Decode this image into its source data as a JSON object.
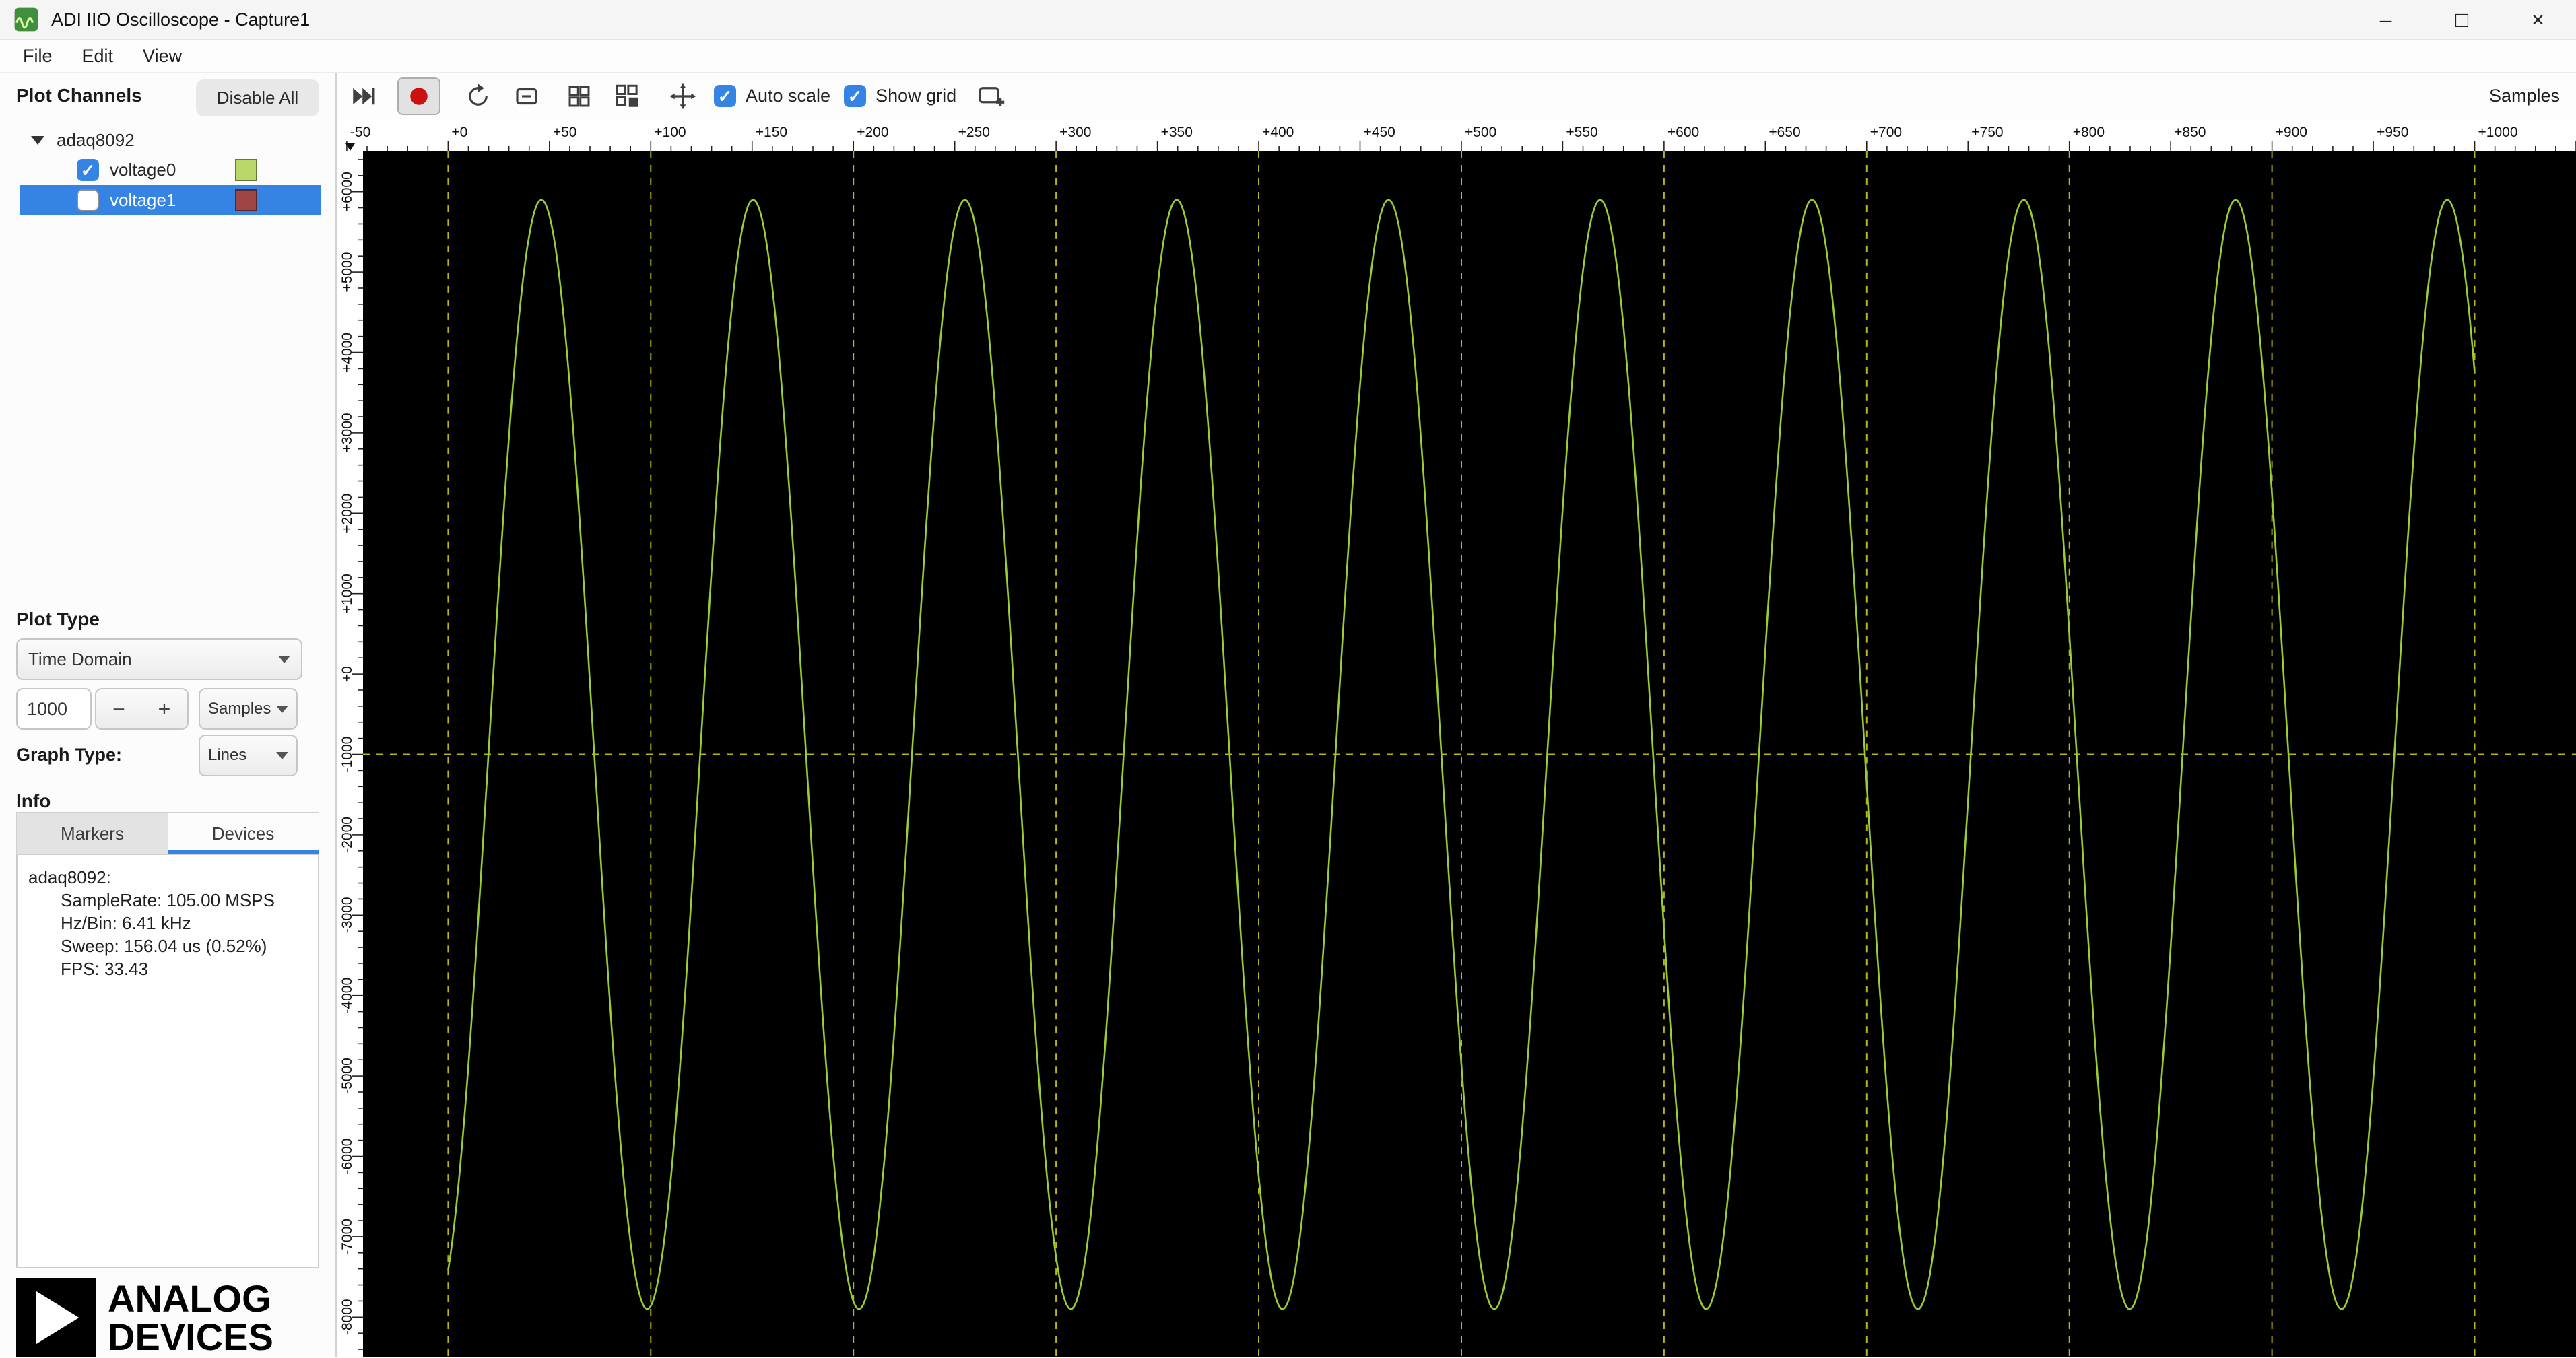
{
  "window": {
    "title": "ADI IIO Oscilloscope - Capture1",
    "controls": {
      "minimize": "–",
      "maximize": "□",
      "close": "×"
    }
  },
  "menu": {
    "items": [
      "File",
      "Edit",
      "View"
    ]
  },
  "toolbar": {
    "icons": [
      "skip-end",
      "record",
      "restart",
      "zoom-out",
      "zoom-fit",
      "export",
      "pan",
      "new-plot"
    ],
    "auto_scale": {
      "label": "Auto scale",
      "checked": true
    },
    "show_grid": {
      "label": "Show grid",
      "checked": true
    },
    "samples_label": "Samples"
  },
  "sidebar": {
    "plot_channels_label": "Plot Channels",
    "disable_all_label": "Disable All",
    "device_tree": {
      "device": "adaq8092",
      "channels": [
        {
          "name": "voltage0",
          "checked": true,
          "selected": false,
          "color": "#b9d869"
        },
        {
          "name": "voltage1",
          "checked": false,
          "selected": true,
          "color": "#a04545"
        }
      ]
    },
    "plot_type_label": "Plot Type",
    "plot_type_value": "Time Domain",
    "sample_count": "1000",
    "sample_unit": "Samples",
    "graph_type_label": "Graph Type:",
    "graph_type_value": "Lines",
    "info_label": "Info",
    "tabs": [
      {
        "label": "Markers",
        "active": false
      },
      {
        "label": "Devices",
        "active": true
      }
    ],
    "device_info": {
      "title": "adaq8092:",
      "lines": [
        "SampleRate: 105.00 MSPS",
        "Hz/Bin: 6.41 kHz",
        "Sweep: 156.04 us (0.52%)",
        "FPS: 33.43"
      ]
    },
    "logo": {
      "line1": "ANALOG",
      "line2": "DEVICES"
    }
  },
  "colors": {
    "accent": "#3584e4",
    "record_red": "#cc1111",
    "plot_background": "#000000"
  },
  "glyphs": {
    "check": "✓",
    "minus": "−",
    "plus": "+"
  },
  "chart_data": {
    "type": "line",
    "title": "",
    "xlabel": "Samples",
    "ylabel": "",
    "x_axis": {
      "min": -42,
      "max": 1050,
      "tick_minor": 10,
      "tick_major": 50,
      "label_min": -50,
      "label_max": 1000
    },
    "y_axis": {
      "min": -8500,
      "max": 6500,
      "tick_minor": 200,
      "tick_major": 1000,
      "label_min": -8000,
      "label_max": 6000
    },
    "grid": {
      "show": true,
      "v_step": 100,
      "v_min": 0,
      "v_max": 1000,
      "h_values": [
        -1000
      ],
      "color": "#b9b416",
      "dash": [
        10,
        10
      ]
    },
    "series": [
      {
        "name": "voltage0",
        "color": "#9acd32",
        "shape": "sine",
        "amplitude": 6900,
        "offset": -1000,
        "period": 104.5,
        "peak_at": 46,
        "x_start": 0,
        "x_end": 1000,
        "points": 1000
      }
    ],
    "plot_background": "#000000"
  }
}
